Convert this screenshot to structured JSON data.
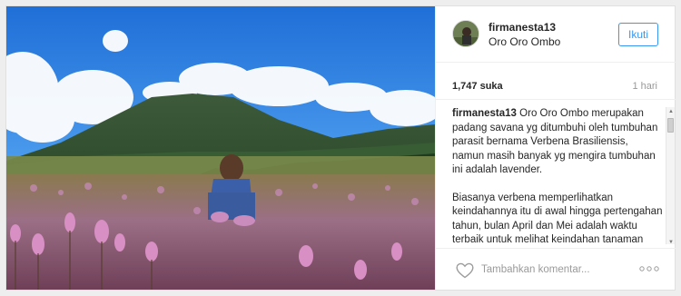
{
  "post": {
    "username": "firmanesta13",
    "location": "Oro Oro Ombo",
    "follow_label": "Ikuti",
    "likes": "1,747 suka",
    "time_ago": "1 hari",
    "caption_user": "firmanesta13",
    "caption_p1": " Oro Oro Ombo merupakan padang savana yg ditumbuhi oleh tumbuhan parasit bernama Verbena Brasiliensis, namun masih banyak yg mengira tumbuhan ini adalah lavender.",
    "caption_p2": "Biasanya verbena memperlihatkan keindahannya itu di awal hingga pertengahan tahun, bulan April dan Mei adalah waktu terbaik untuk melihat keindahan tanaman parasit ini.",
    "comment_placeholder": "Tambahkan komentar...",
    "scroll_up_glyph": "▲",
    "scroll_down_glyph": "▼"
  },
  "colors": {
    "follow_blue": "#3897f0",
    "sky": "#3f8fe6",
    "flowers": "#b46aa6"
  },
  "icons": {
    "like": "heart-icon",
    "more": "more-options-icon"
  }
}
